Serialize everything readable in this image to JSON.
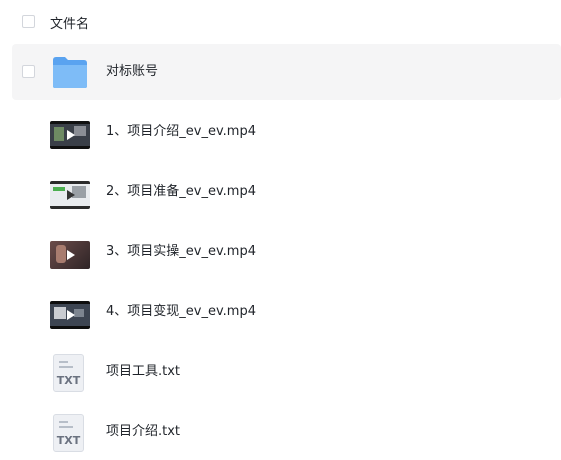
{
  "header": {
    "column_label": "文件名"
  },
  "files": [
    {
      "name": "对标账号",
      "type": "folder"
    },
    {
      "name": "1、项目介绍_ev_ev.mp4",
      "type": "video"
    },
    {
      "name": "2、项目准备_ev_ev.mp4",
      "type": "video"
    },
    {
      "name": "3、项目实操_ev_ev.mp4",
      "type": "video"
    },
    {
      "name": "4、项目变现_ev_ev.mp4",
      "type": "video"
    },
    {
      "name": "项目工具.txt",
      "type": "txt",
      "icon_label": "TXT"
    },
    {
      "name": "项目介绍.txt",
      "type": "txt",
      "icon_label": "TXT"
    }
  ],
  "colors": {
    "folder": "#6aaef5",
    "selected_row_bg": "#f5f5f6"
  }
}
